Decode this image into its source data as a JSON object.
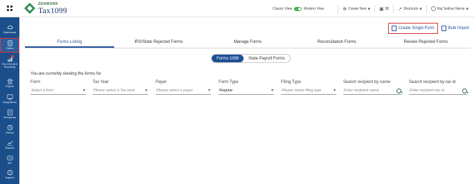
{
  "header": {
    "brand_top": "ZENWORK",
    "brand_name": "Tax1099",
    "classic_view": "Classic View",
    "modern_view": "Modern View",
    "create_new": "Create New",
    "balance": "$0",
    "shortcuts": "Shortcuts",
    "user_name": "Raj Sekhar Narne"
  },
  "sidebar": {
    "items": [
      {
        "label": "Dashboard",
        "icon": "cloud-icon"
      },
      {
        "label": "Forms",
        "icon": "document-icon"
      },
      {
        "label": "FIN CEN BOI Reporting",
        "icon": "chart-icon",
        "badge": "new"
      },
      {
        "label": "Payers",
        "icon": "bank-icon"
      },
      {
        "label": "Integrations",
        "icon": "integration-icon"
      },
      {
        "label": "Recipients",
        "icon": "recipient-icon"
      },
      {
        "label": "History",
        "icon": "clock-icon"
      },
      {
        "label": "Reports",
        "icon": "bar-chart-icon"
      },
      {
        "label": "API",
        "icon": "api-icon"
      },
      {
        "label": "Support",
        "icon": "help-icon"
      }
    ]
  },
  "actions": {
    "create_single": "Create Single Form",
    "bulk_import": "Bulk Import"
  },
  "tabs": [
    "Forms Listing",
    "IRS/State Rejected Forms",
    "Manage Forms",
    "Reconciliation Forms",
    "Review Rejected Forms"
  ],
  "active_tab": "Forms Listing",
  "subtabs": [
    "Forms 1099",
    "State Payroll Forms"
  ],
  "active_subtab": "Forms 1099",
  "viewing_text": "You are currently viewing the forms for",
  "filters": {
    "form": {
      "label": "Form",
      "placeholder": "Select a form"
    },
    "tax_year": {
      "label": "Tax Year",
      "placeholder": "Please select a Tax year"
    },
    "payer": {
      "label": "Payer",
      "placeholder": "Please select a payer"
    },
    "form_type": {
      "label": "Form Type",
      "value": "Regular"
    },
    "filing_type": {
      "label": "Filing Type",
      "placeholder": "Please select filing type"
    },
    "search_name": {
      "label": "Search recipient by name",
      "placeholder": "Enter recipient name"
    },
    "search_tax": {
      "label": "Search recipient by tax id",
      "placeholder": "Enter recipient tax id"
    }
  },
  "colors": {
    "sidebar": "#1b4f8c",
    "accent": "#1e4f95",
    "highlight": "#d32f2f",
    "toggle": "#4caf50"
  }
}
